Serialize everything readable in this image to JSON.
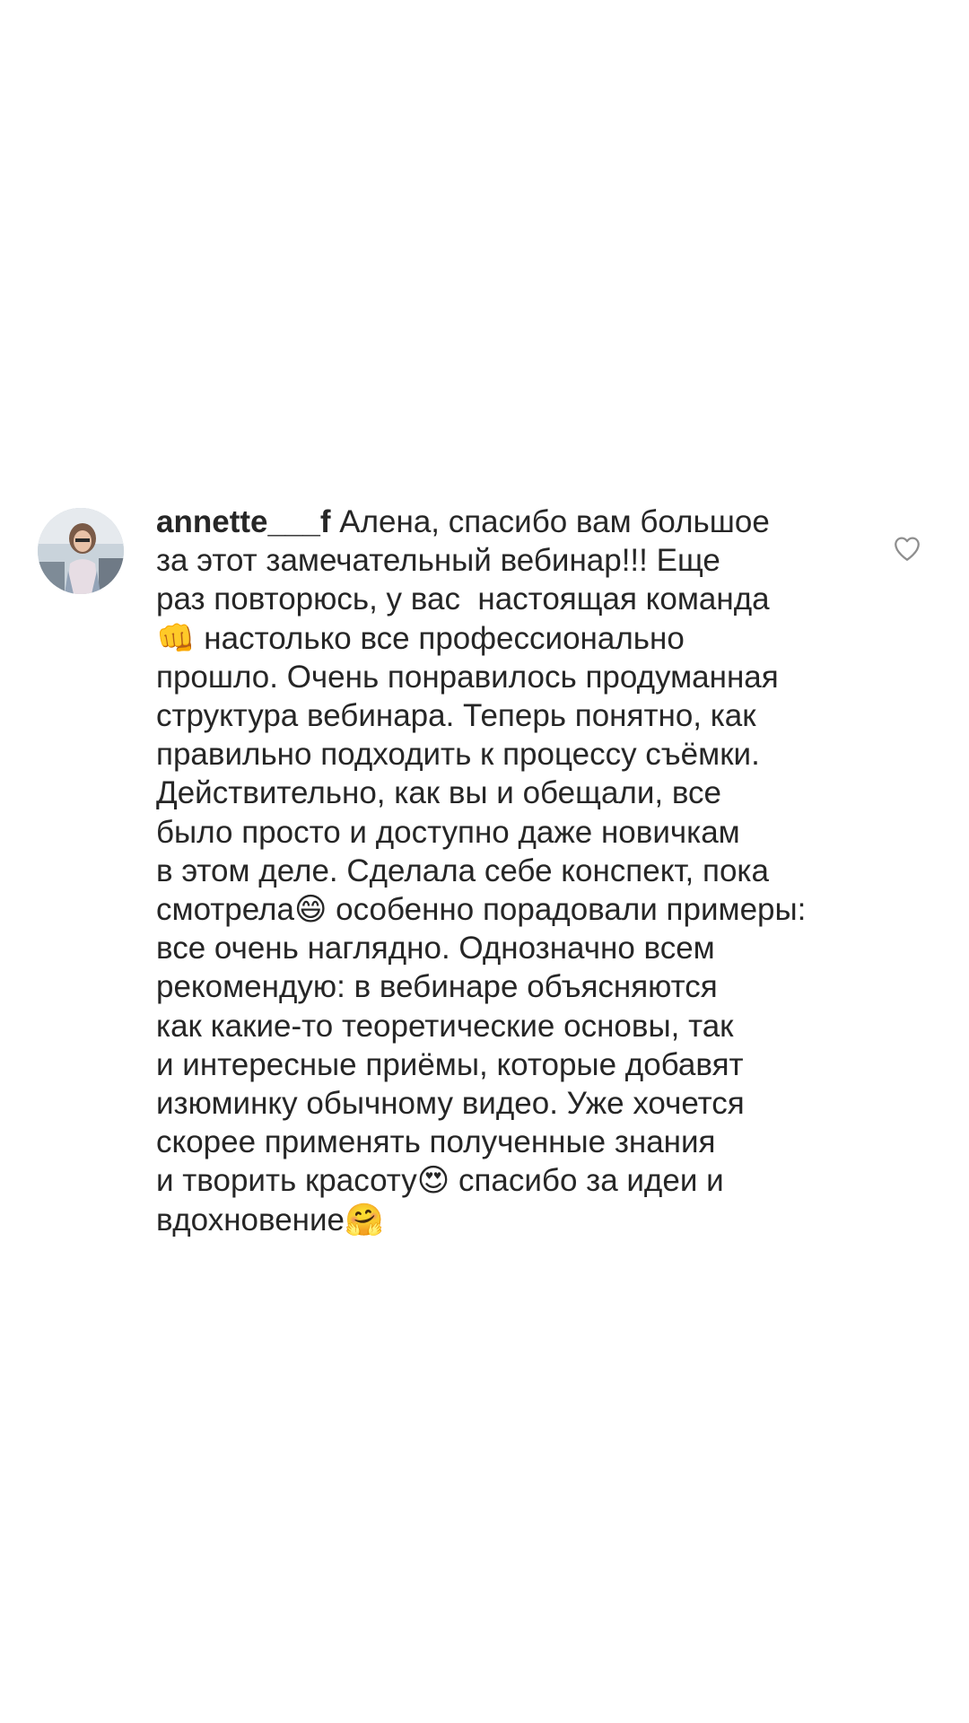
{
  "comment": {
    "username": "annette___f",
    "lines": [
      " Алена, спасибо вам большое",
      "за этот замечательный вебинар!!! Еще",
      "раз повторюсь, у вас  настоящая команда",
      "👊 настолько все профессионально",
      "прошло. Очень понравилось продуманная",
      "структура вебинара. Теперь понятно, как",
      "правильно подходить к процессу съёмки.",
      "Действительно, как вы и обещали, все",
      "было просто и доступно даже новичкам",
      "в этом деле. Сделала себе конспект, пока",
      "смотрела😄 особенно порадовали примеры:",
      "все очень наглядно. Однозначно всем",
      "рекомендую: в вебинаре объясняются",
      "как какие-то теоретические основы, так",
      "и интересные приёмы, которые добавят",
      "изюминку обычному видео. Уже хочется",
      "скорее применять полученные знания",
      "и творить красоту😍 спасибо за идеи и",
      "вдохновение🤗"
    ],
    "like_icon": "heart-outline-icon",
    "avatar_icon": "user-avatar"
  },
  "colors": {
    "text": "#262626",
    "icon": "#8e8e8e",
    "background": "#ffffff"
  }
}
